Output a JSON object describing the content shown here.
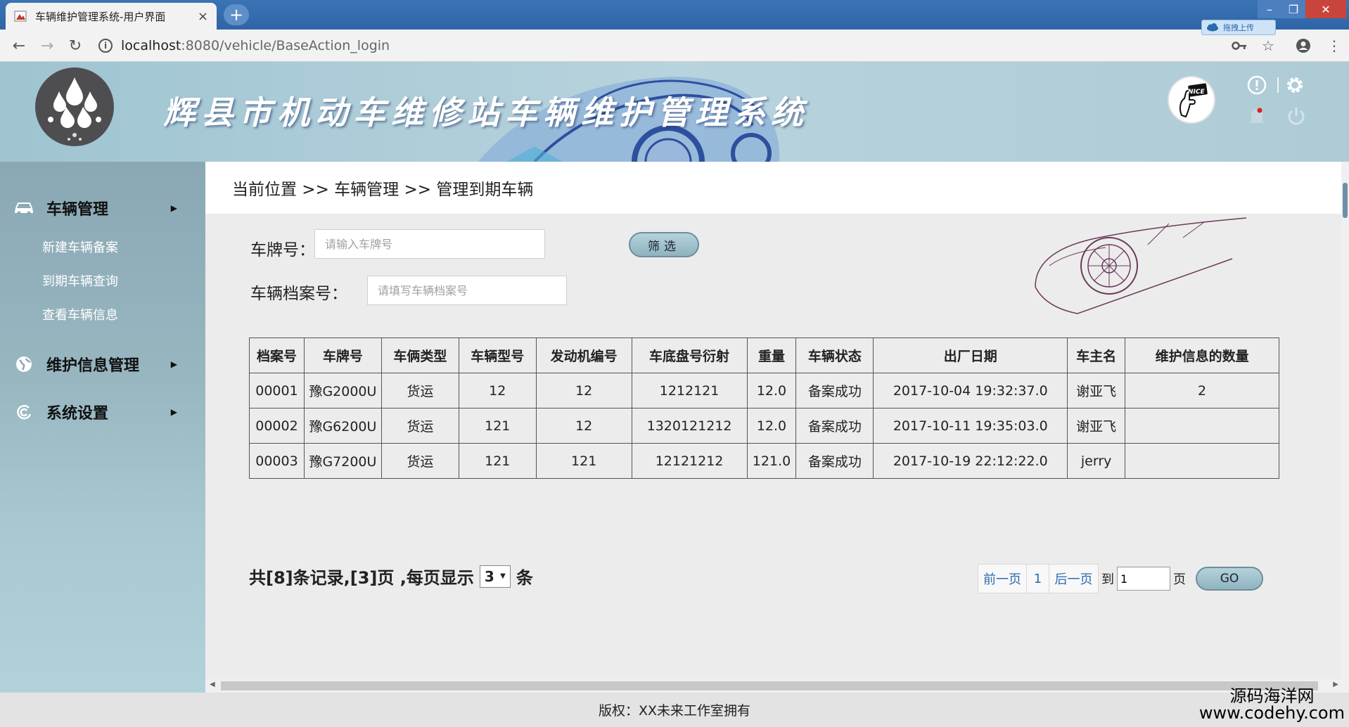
{
  "browser": {
    "tab_title": "车辆维护管理系统-用户界面",
    "tab_close": "×",
    "new_tab": "+",
    "url_host": "localhost",
    "url_path": ":8080/vehicle/BaseAction_login",
    "upload_badge": "拖拽上传",
    "window_controls": {
      "minimize": "–",
      "maximize": "❐",
      "close": "✕"
    }
  },
  "header": {
    "site_title": "辉县市机动车维修站车辆维护管理系统",
    "avatar_text": "NICE"
  },
  "sidebar": {
    "sections": [
      {
        "label": "车辆管理",
        "icon": "car-icon",
        "items": [
          "新建车辆备案",
          "到期车辆查询",
          "查看车辆信息"
        ]
      },
      {
        "label": "维护信息管理",
        "icon": "globe-icon",
        "items": []
      },
      {
        "label": "系统设置",
        "icon": "settings-swirl-icon",
        "items": []
      }
    ]
  },
  "breadcrumb": "当前位置 >> 车辆管理 >> 管理到期车辆",
  "filters": {
    "plate_label": "车牌号：",
    "plate_placeholder": "请输入车牌号",
    "archive_label": "车辆档案号：",
    "archive_placeholder": "请填写车辆档案号",
    "filter_button": "筛选"
  },
  "table": {
    "columns": [
      "档案号",
      "车牌号",
      "车俩类型",
      "车辆型号",
      "发动机编号",
      "车底盘号衍射",
      "重量",
      "车辆状态",
      "出厂日期",
      "车主名",
      "维护信息的数量"
    ],
    "rows": [
      [
        "00001",
        "豫G2000U",
        "货运",
        "12",
        "12",
        "1212121",
        "12.0",
        "备案成功",
        "2017-10-04 19:32:37.0",
        "谢亚飞",
        "2"
      ],
      [
        "00002",
        "豫G6200U",
        "货运",
        "121",
        "12",
        "1320121212",
        "12.0",
        "备案成功",
        "2017-10-11 19:35:03.0",
        "谢亚飞",
        ""
      ],
      [
        "00003",
        "豫G7200U",
        "货运",
        "121",
        "121",
        "12121212",
        "121.0",
        "备案成功",
        "2017-10-19 22:12:22.0",
        "jerry",
        ""
      ]
    ]
  },
  "pagination": {
    "summary_prefix": "共[8]条记录,[3]页 ,每页显示",
    "page_size": "3",
    "summary_suffix": "条",
    "prev": "前一页",
    "current": "1",
    "next": "后一页",
    "goto_label": "到",
    "goto_value": "1",
    "page_unit": "页",
    "go_button": "GO"
  },
  "footer": "版权：XX未来工作室拥有",
  "watermark": {
    "line1": "源码海洋网",
    "line2": "www.codehy.com"
  },
  "colors": {
    "header_bg": "#b7d3dd",
    "sidebar_bg": "#97b6c0",
    "button_bg": "#a3c4cf",
    "link": "#2a6ab0"
  }
}
